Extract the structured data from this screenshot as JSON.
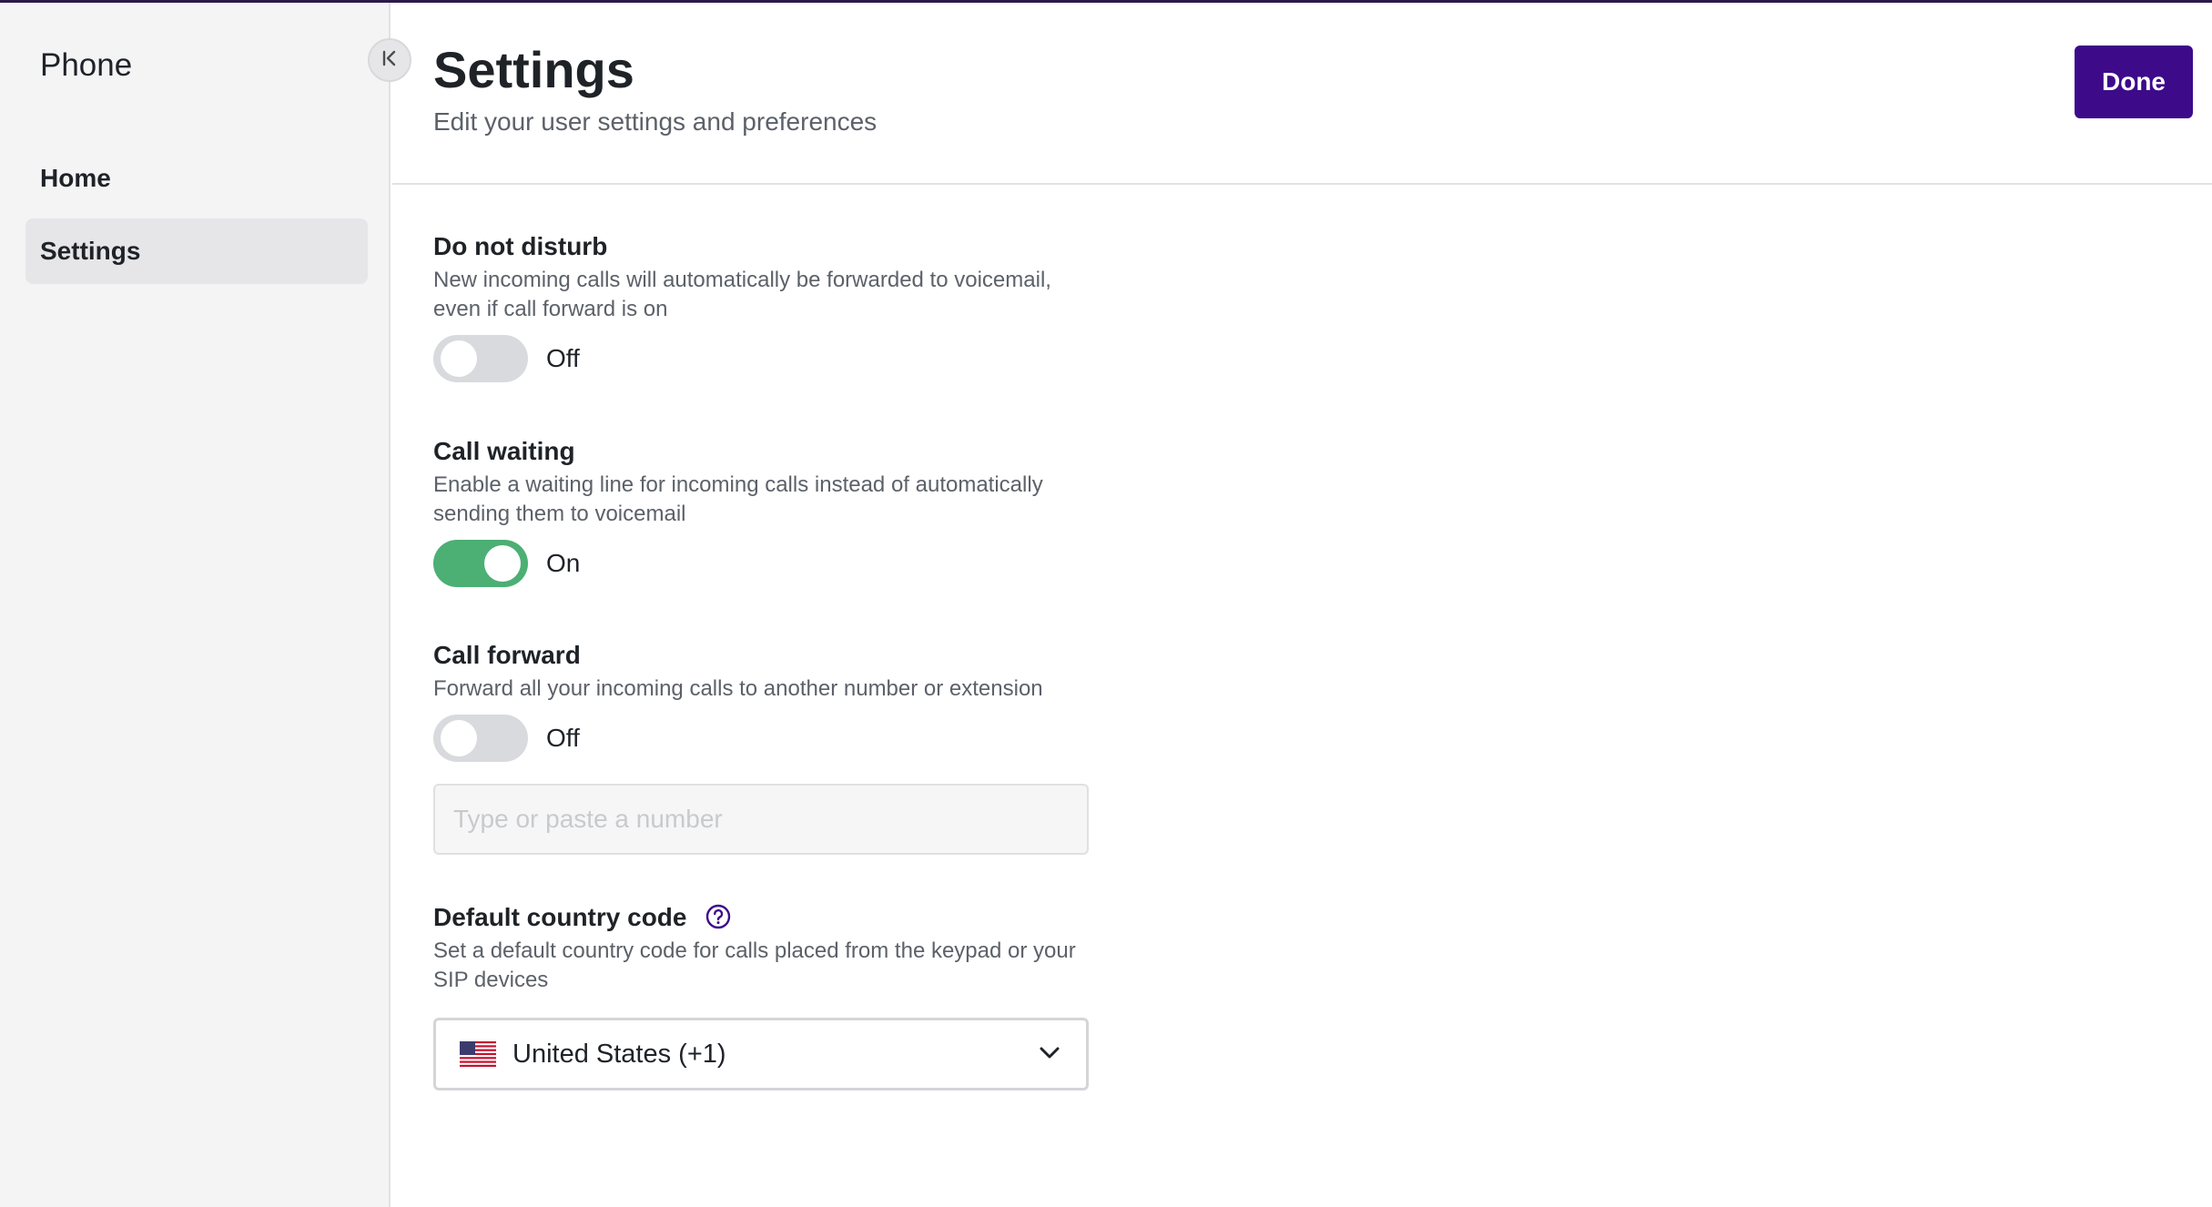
{
  "sidebar": {
    "app_title": "Phone",
    "nav": [
      {
        "label": "Home",
        "active": false
      },
      {
        "label": "Settings",
        "active": true
      }
    ],
    "collapse_icon": "collapse-left-icon"
  },
  "header": {
    "title": "Settings",
    "subtitle": "Edit your user settings and preferences",
    "done_label": "Done"
  },
  "settings": {
    "do_not_disturb": {
      "title": "Do not disturb",
      "description_line1": "New incoming calls will automatically be forwarded to voicemail,",
      "description_line2": "even if call forward is on",
      "state": "Off",
      "enabled": false
    },
    "call_waiting": {
      "title": "Call waiting",
      "description_line1": "Enable a waiting line for incoming calls instead of automatically",
      "description_line2": "sending them to voicemail",
      "state": "On",
      "enabled": true
    },
    "call_forward": {
      "title": "Call forward",
      "description": "Forward all your incoming calls to another number or extension",
      "state": "Off",
      "enabled": false,
      "input_placeholder": "Type or paste a number",
      "input_value": ""
    },
    "default_country_code": {
      "title": "Default country code",
      "help_icon": "help-circle-icon",
      "description_line1": "Set a default country code for calls placed from the keypad or your",
      "description_line2": "SIP devices",
      "selected": "United States (+1)",
      "flag_icon": "us-flag-icon"
    }
  },
  "colors": {
    "brand": "#3d0a8a",
    "toggle_on": "#4caf74",
    "toggle_off": "#d8dadd",
    "sidebar_bg": "#f4f4f5"
  }
}
